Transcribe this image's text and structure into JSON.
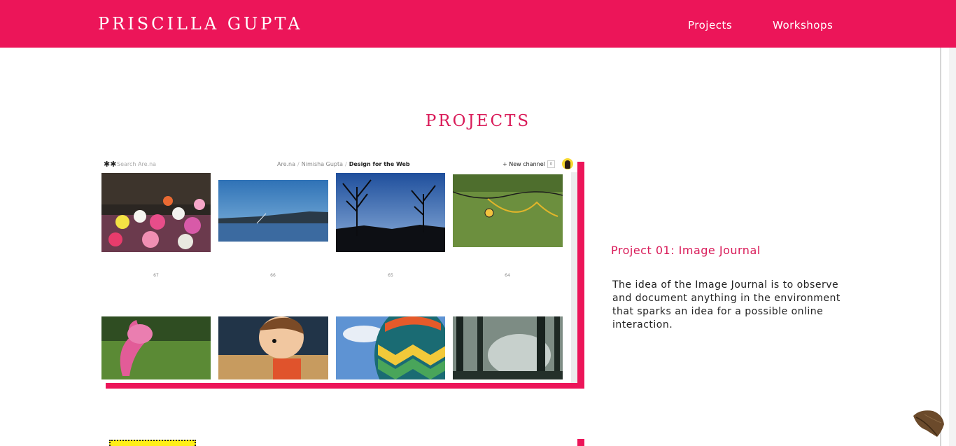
{
  "header": {
    "brand": "PRISCILLA GUPTA",
    "nav": [
      "Projects",
      "Workshops"
    ]
  },
  "section": {
    "title": "PROJECTS"
  },
  "project": {
    "title": "Project 01: Image Journal",
    "description": "The idea of the Image Journal is to observe and document anything in the environment that sparks an idea for a possible online interaction."
  },
  "screenshot": {
    "logo": "✱✱",
    "search_placeholder": "Search Are.na",
    "breadcrumb": [
      "Are.na",
      "Nimisha Gupta",
      "Design for the Web"
    ],
    "new_channel": "+ New channel",
    "count": "0",
    "block_numbers": [
      "67",
      "66",
      "65",
      "64"
    ]
  },
  "colors": {
    "accent": "#ec1559",
    "title": "#d91a58",
    "highlight": "#ffef18"
  }
}
